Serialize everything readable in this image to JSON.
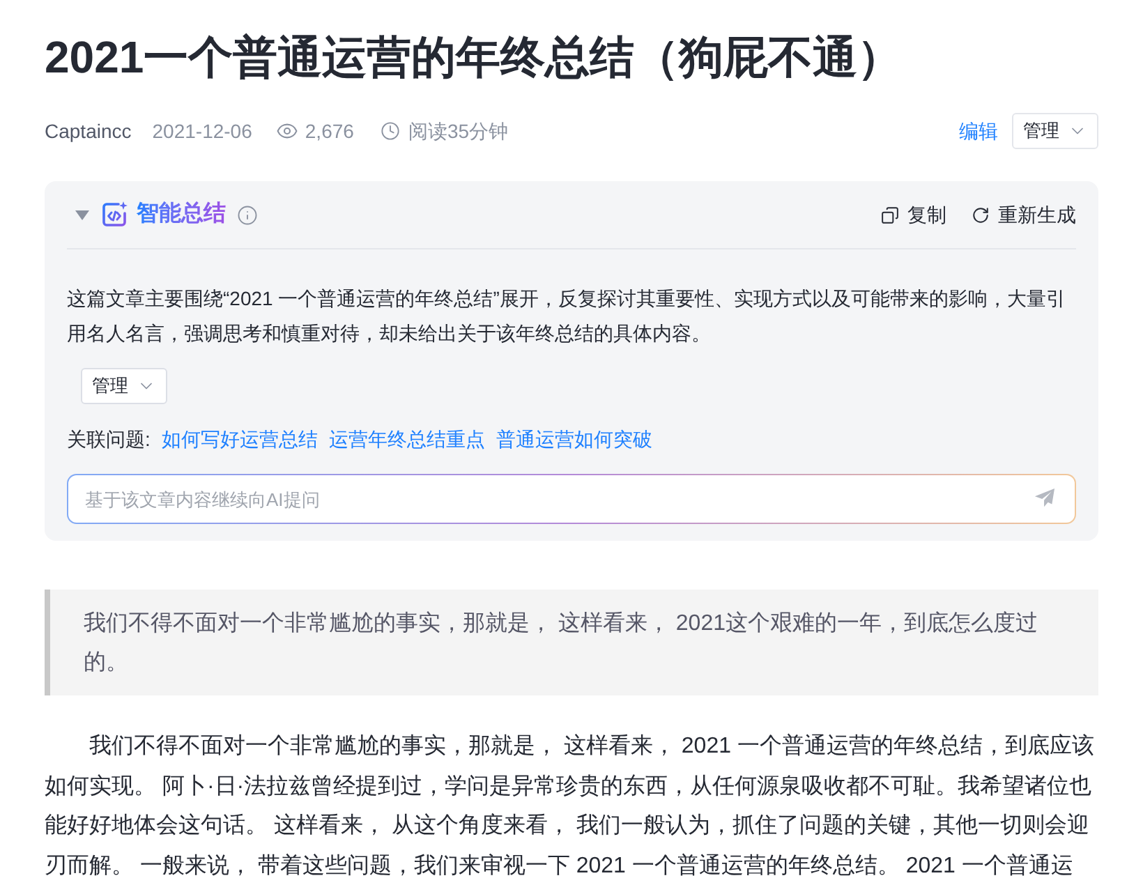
{
  "article": {
    "title": "2021一个普通运营的年终总结（狗屁不通）",
    "author": "Captaincc",
    "date": "2021-12-06",
    "views": "2,676",
    "read_time": "阅读35分钟"
  },
  "actions": [
    {
      "kind": "link",
      "label": "编辑"
    },
    {
      "kind": "select",
      "label": "管理"
    }
  ],
  "ai_summary": {
    "expanded": true,
    "title": "智能总结",
    "tools": [
      {
        "kind": "copy",
        "label": "复制"
      },
      {
        "kind": "regenerate",
        "label": "重新生成"
      }
    ],
    "summary": "这篇文章主要围绕“2021 一个普通运营的年终总结”展开，反复探讨其重要性、实现方式以及可能带来的影响，大量引用名人名言，强调思考和慎重对待，却未给出关于该年终总结的具体内容。",
    "manage": "管理",
    "related_label": "关联问题:",
    "related": [
      "如何写好运营总结",
      "运营年终总结重点",
      "普通运营如何突破"
    ],
    "input": {
      "placeholder": "基于该文章内容继续向AI提问"
    }
  },
  "quote": "我们不得不面对一个非常尴尬的事实，那就是， 这样看来， 2021这个艰难的一年，到底怎么度过的。",
  "paragraphs": [
    "我们不得不面对一个非常尴尬的事实，那就是， 这样看来， 2021 一个普通运营的年终总结，到底应该如何实现。 阿卜·日·法拉兹曾经提到过，学问是异常珍贵的东西，从任何源泉吸收都不可耻。我希望诸位也能好好地体会这句话。 这样看来， 从这个角度来看， 我们一般认为，抓住了问题的关键，其他一切则会迎刃而解。 一般来说， 带着这些问题，我们来审视一下 2021 一个普通运营的年终总结。 2021 一个普通运"
  ]
}
